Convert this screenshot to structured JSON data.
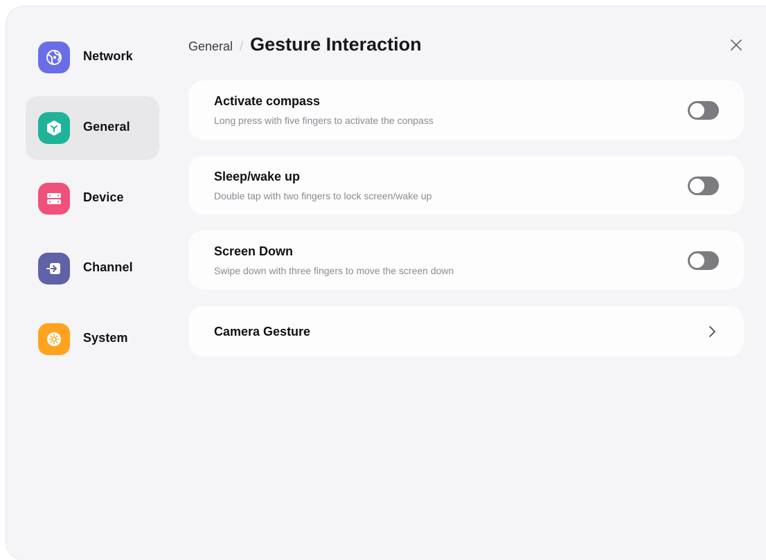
{
  "sidebar": {
    "items": [
      {
        "label": "Network",
        "icon": "network-globe-icon",
        "color": "#6a6ee6"
      },
      {
        "label": "General",
        "icon": "cube-icon",
        "color": "#1fb39a",
        "active": true
      },
      {
        "label": "Device",
        "icon": "server-icon",
        "color": "#f0507a"
      },
      {
        "label": "Channel",
        "icon": "input-arrow-icon",
        "color": "#5f62a6"
      },
      {
        "label": "System",
        "icon": "gear-icon",
        "color": "#ffa21e"
      }
    ]
  },
  "header": {
    "breadcrumb_parent": "General",
    "breadcrumb_separator": "/",
    "title": "Gesture Interaction",
    "close_icon": "close-icon"
  },
  "settings": [
    {
      "title": "Activate compass",
      "description": "Long press with five fingers to activate the conpass",
      "toggle_on": false
    },
    {
      "title": "Sleep/wake up",
      "description": "Double tap with two fingers to lock screen/wake up",
      "toggle_on": false
    },
    {
      "title": "Screen Down",
      "description": "Swipe down with three fingers to move the screen down",
      "toggle_on": false
    }
  ],
  "camera_gesture": {
    "title": "Camera Gesture",
    "icon": "chevron-right-icon"
  }
}
